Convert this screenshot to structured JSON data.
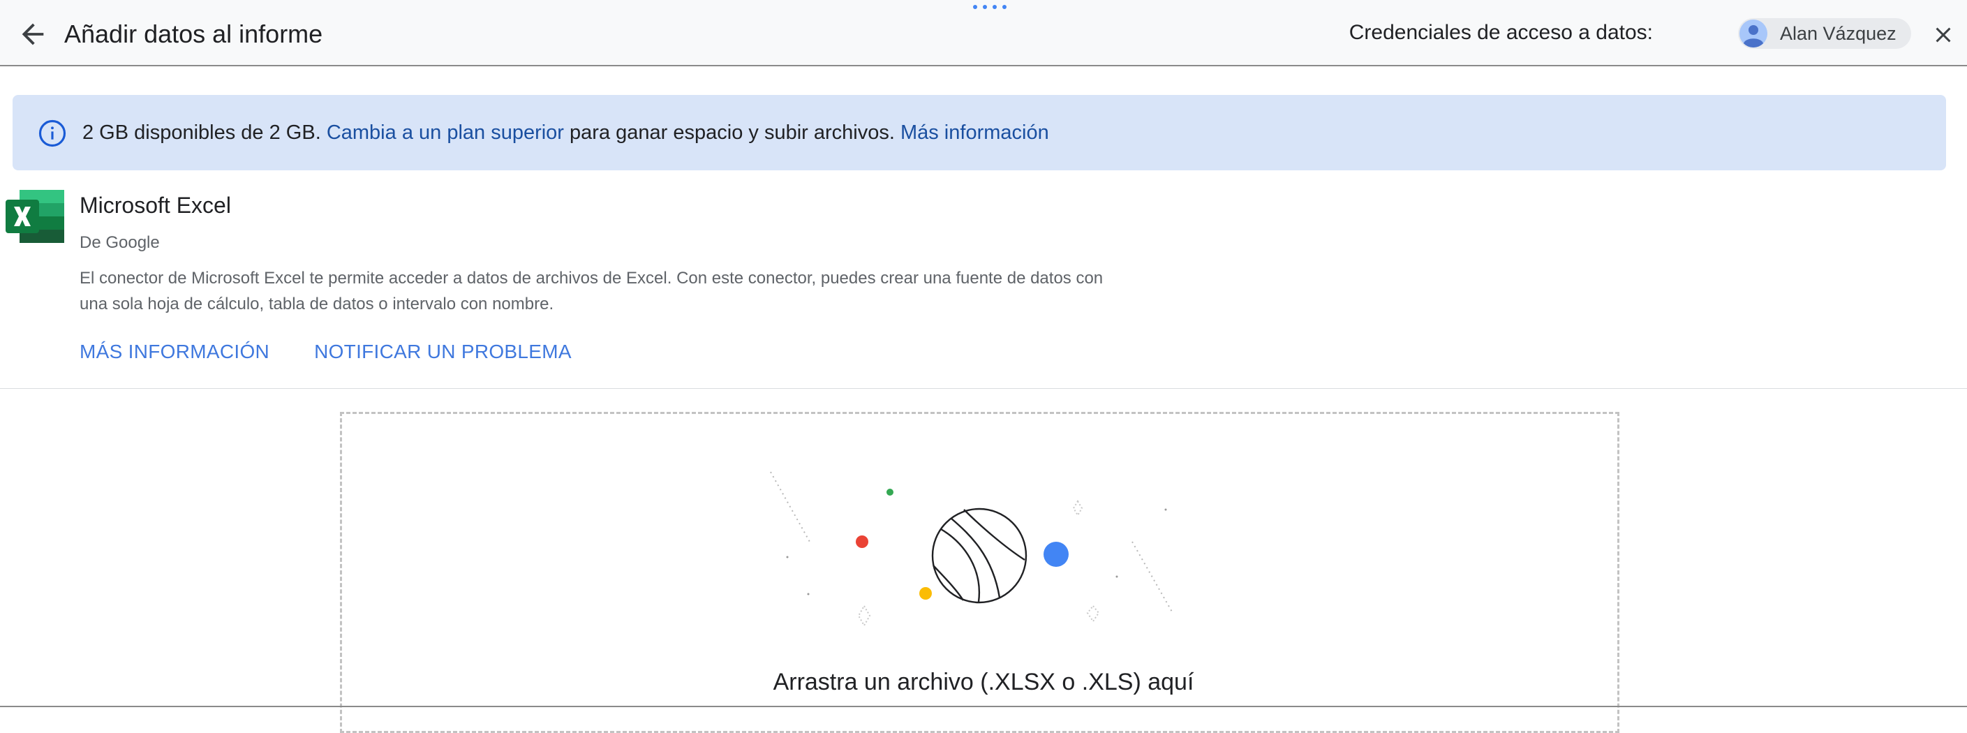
{
  "header": {
    "title": "Añadir datos al informe",
    "credentials_label": "Credenciales de acceso a datos:",
    "user_name": "Alan Vázquez"
  },
  "banner": {
    "storage_text": "2 GB disponibles de 2 GB.",
    "upgrade_link": "Cambia a un plan superior",
    "middle_text": "para ganar espacio y subir archivos.",
    "more_info_link": "Más información",
    "icon": "info-icon"
  },
  "connector": {
    "name": "Microsoft Excel",
    "by": "De Google",
    "description": "El conector de Microsoft Excel te permite acceder a datos de archivos de Excel. Con este conector, puedes crear una fuente de datos con una sola hoja de cálculo, tabla de datos o intervalo con nombre.",
    "learn_more": "MÁS INFORMACIÓN",
    "report_problem": "NOTIFICAR UN PROBLEMA"
  },
  "dropzone": {
    "text": "Arrastra un archivo (.XLSX o .XLS) aquí"
  },
  "colors": {
    "accent": "#3f78de",
    "banner_bg": "#d8e4f8",
    "link_dark": "#1a4fa0"
  }
}
